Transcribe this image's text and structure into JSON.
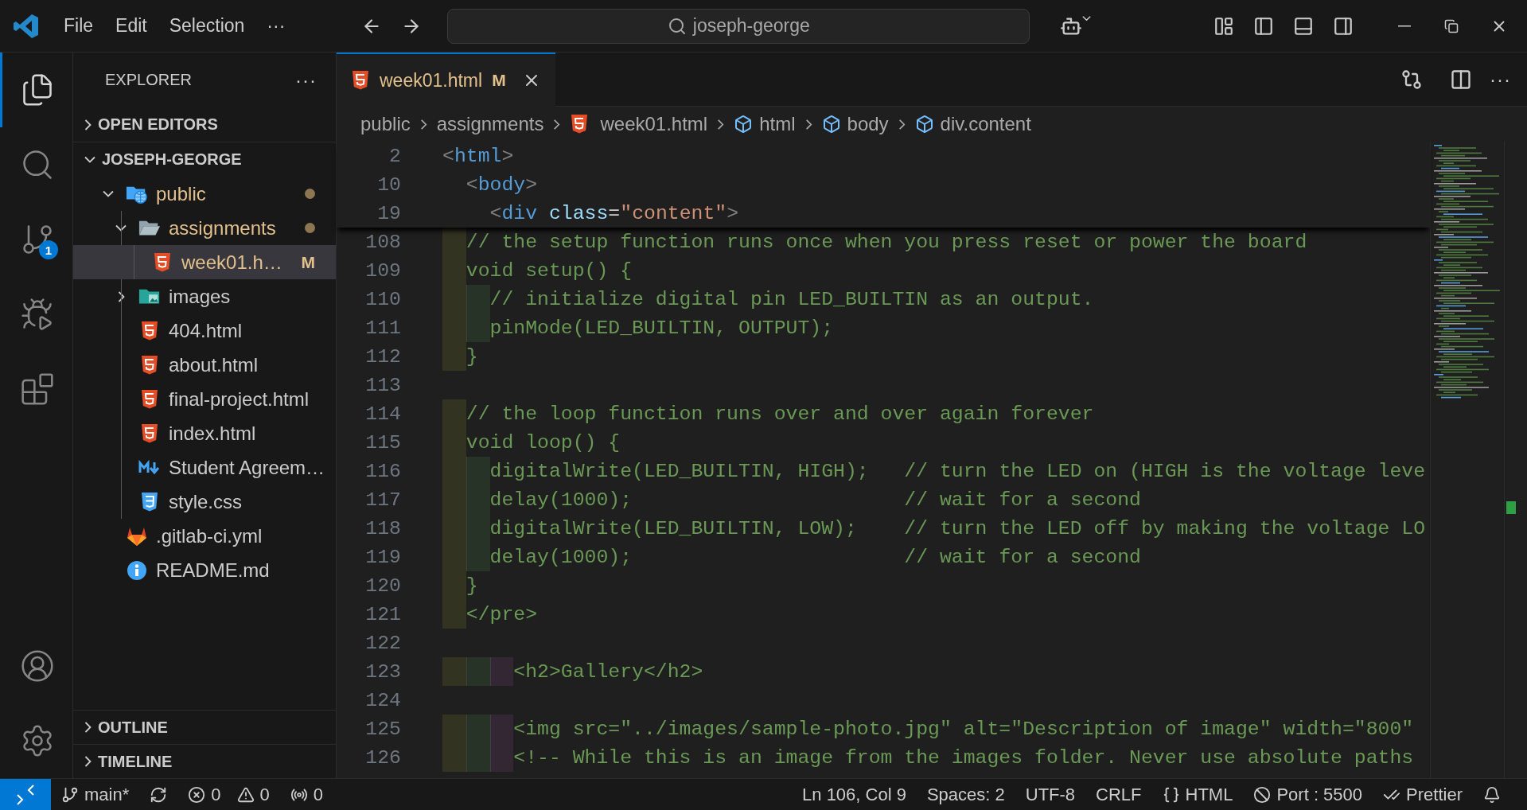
{
  "title_bar": {
    "menu": [
      "File",
      "Edit",
      "Selection",
      "···"
    ],
    "search": "joseph-george"
  },
  "activity_bar": {
    "items": [
      {
        "kind": "explorer",
        "selected": true
      },
      {
        "kind": "search",
        "selected": false
      },
      {
        "kind": "source-control",
        "selected": false,
        "badge": "1"
      },
      {
        "kind": "run",
        "selected": false
      },
      {
        "kind": "extensions",
        "selected": false
      }
    ],
    "bottom": [
      {
        "kind": "account"
      },
      {
        "kind": "settings"
      }
    ]
  },
  "sidebar": {
    "title": "EXPLORER",
    "menu": "···",
    "sections": [
      {
        "title": "OPEN EDITORS",
        "expanded": false
      },
      {
        "title": "JOSEPH-GEORGE",
        "expanded": true,
        "tree": [
          {
            "label": "public",
            "kind": "folder-web",
            "expanded": true,
            "modified": true,
            "selected": false,
            "children": [
              {
                "label": "assignments",
                "kind": "folder",
                "expanded": true,
                "modified": true,
                "selected": false,
                "children": [
                  {
                    "label": "week01.h…",
                    "kind": "html",
                    "modified": true,
                    "selected": true,
                    "badge": "M"
                  }
                ]
              },
              {
                "label": "images",
                "kind": "folder-images",
                "expanded": false,
                "modified": false,
                "selected": false
              },
              {
                "label": "404.html",
                "kind": "html",
                "modified": false,
                "selected": false
              },
              {
                "label": "about.html",
                "kind": "html",
                "modified": false,
                "selected": false
              },
              {
                "label": "final-project.html",
                "kind": "html",
                "modified": false,
                "selected": false
              },
              {
                "label": "index.html",
                "kind": "html",
                "modified": false,
                "selected": false
              },
              {
                "label": "Student Agreem…",
                "kind": "markdown",
                "modified": false,
                "selected": false
              },
              {
                "label": "style.css",
                "kind": "css",
                "modified": false,
                "selected": false
              }
            ]
          },
          {
            "label": ".gitlab-ci.yml",
            "kind": "gitlab",
            "modified": false,
            "selected": false
          },
          {
            "label": "README.md",
            "kind": "info",
            "modified": false,
            "selected": false
          }
        ]
      }
    ],
    "bottom_sections": [
      {
        "title": "OUTLINE",
        "expanded": false
      },
      {
        "title": "TIMELINE",
        "expanded": false
      }
    ]
  },
  "editor": {
    "tabs": [
      {
        "label": "week01.html",
        "kind": "html",
        "badge": "M",
        "selected": true
      }
    ],
    "tab_menu": "···",
    "breadcrumb": [
      {
        "label": "public",
        "kind": "folder"
      },
      {
        "label": "assignments",
        "kind": "folder"
      },
      {
        "label": "week01.html",
        "kind": "html"
      },
      {
        "label": "html",
        "kind": "element"
      },
      {
        "label": "body",
        "kind": "element"
      },
      {
        "label": "div.content",
        "kind": "element"
      }
    ],
    "sticky_lines": [
      {
        "number": "2",
        "tokens": [
          {
            "kind": "punct",
            "text": "<"
          },
          {
            "kind": "tag",
            "text": "html"
          },
          {
            "kind": "punct",
            "text": ">"
          }
        ]
      },
      {
        "number": "10",
        "tokens": [
          {
            "kind": "punct",
            "text": "  <"
          },
          {
            "kind": "tag",
            "text": "body"
          },
          {
            "kind": "punct",
            "text": ">"
          }
        ]
      },
      {
        "number": "19",
        "tokens": [
          {
            "kind": "punct",
            "text": "    <"
          },
          {
            "kind": "tag",
            "text": "div"
          },
          {
            "kind": "attr",
            "text": " class"
          },
          {
            "kind": "plain",
            "text": "="
          },
          {
            "kind": "string",
            "text": "\"content\""
          },
          {
            "kind": "punct",
            "text": ">"
          }
        ]
      }
    ],
    "lines": [
      {
        "number": "108",
        "tokens": [
          {
            "kind": "content",
            "text": "  // the setup function runs once when you press reset or power the board"
          }
        ]
      },
      {
        "number": "109",
        "tokens": [
          {
            "kind": "content",
            "text": "  void setup() {"
          }
        ]
      },
      {
        "number": "110",
        "tokens": [
          {
            "kind": "content",
            "text": "    // initialize digital pin LED_BUILTIN as an output."
          }
        ]
      },
      {
        "number": "111",
        "tokens": [
          {
            "kind": "content",
            "text": "    pinMode(LED_BUILTIN, OUTPUT);"
          }
        ]
      },
      {
        "number": "112",
        "tokens": [
          {
            "kind": "content",
            "text": "  }"
          }
        ]
      },
      {
        "number": "113"
      },
      {
        "number": "114",
        "tokens": [
          {
            "kind": "content",
            "text": "  // the loop function runs over and over again forever"
          }
        ]
      },
      {
        "number": "115",
        "tokens": [
          {
            "kind": "content",
            "text": "  void loop() {"
          }
        ]
      },
      {
        "number": "116",
        "tokens": [
          {
            "kind": "content",
            "text": "    digitalWrite(LED_BUILTIN, HIGH);   // turn the LED on (HIGH is the voltage leve"
          }
        ]
      },
      {
        "number": "117",
        "tokens": [
          {
            "kind": "content",
            "text": "    delay(1000);                       // wait for a second"
          }
        ]
      },
      {
        "number": "118",
        "tokens": [
          {
            "kind": "content",
            "text": "    digitalWrite(LED_BUILTIN, LOW);    // turn the LED off by making the voltage LO"
          }
        ]
      },
      {
        "number": "119",
        "tokens": [
          {
            "kind": "content",
            "text": "    delay(1000);                       // wait for a second"
          }
        ]
      },
      {
        "number": "120",
        "tokens": [
          {
            "kind": "content",
            "text": "  }"
          }
        ]
      },
      {
        "number": "121",
        "tokens": [
          {
            "kind": "content",
            "text": "  </pre>"
          }
        ]
      },
      {
        "number": "122"
      },
      {
        "number": "123",
        "tokens": [
          {
            "kind": "content",
            "text": "      <h2>Gallery</h2>"
          }
        ]
      },
      {
        "number": "124"
      },
      {
        "number": "125",
        "tokens": [
          {
            "kind": "content",
            "text": "      <img src=\"../images/sample-photo.jpg\" alt=\"Description of image\" width=\"800\""
          }
        ]
      },
      {
        "number": "126",
        "tokens": [
          {
            "kind": "content",
            "text": "      <!-- While this is an image from the images folder. Never use absolute paths"
          }
        ]
      }
    ]
  },
  "status_bar": {
    "branch": "main*",
    "errors": "0",
    "warnings": "0",
    "ports": "0",
    "right": [
      {
        "kind": "text",
        "label": "Ln 106, Col 9"
      },
      {
        "kind": "text",
        "label": "Spaces: 2"
      },
      {
        "kind": "text",
        "label": "UTF-8"
      },
      {
        "kind": "text",
        "label": "CRLF"
      },
      {
        "kind": "language",
        "label": "HTML"
      },
      {
        "kind": "port",
        "label": "Port : 5500"
      },
      {
        "kind": "formatter",
        "label": "Prettier"
      },
      {
        "kind": "bell"
      }
    ]
  }
}
